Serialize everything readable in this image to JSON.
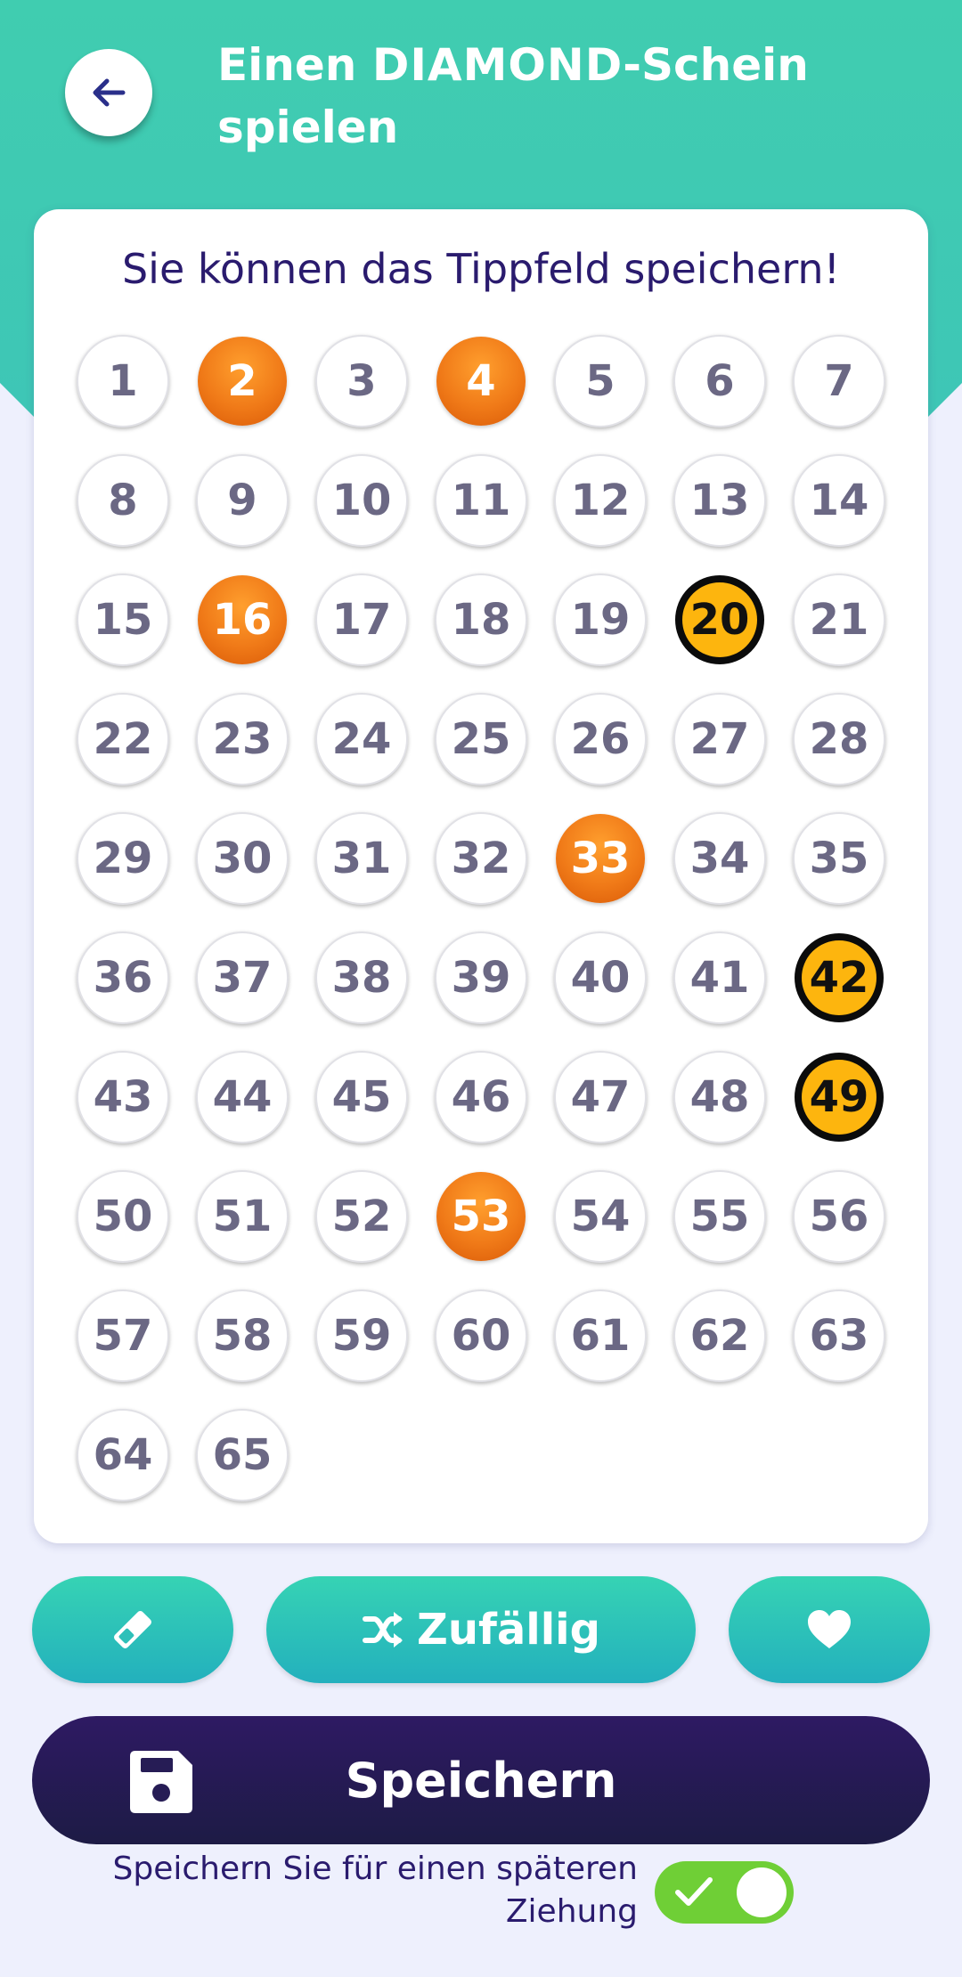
{
  "header": {
    "title_prefix": "Einen ",
    "title_brand": "DIAMOND",
    "title_suffix": "-Schein",
    "title_line2": "spielen"
  },
  "card": {
    "info": "Sie können das Tippfeld speichern!"
  },
  "numbers": {
    "max": 65,
    "columns": 7,
    "selected": [
      2,
      4,
      16,
      33,
      53
    ],
    "bonus": [
      20,
      42,
      49
    ]
  },
  "actions": {
    "random_label": "Zufällig",
    "save_label": "Speichern"
  },
  "later_draw": {
    "line1": "Speichern Sie für einen späteren",
    "line2": "Ziehung",
    "enabled": true
  },
  "colors": {
    "header": "#40cdb0",
    "selected": "#f07a18",
    "bonus": "#fdb50e",
    "save_button": "#2e1a63",
    "toggle_on": "#6fcf36"
  },
  "icons": [
    "arrow-left-icon",
    "eraser-icon",
    "shuffle-icon",
    "heart-icon",
    "floppy-disk-icon",
    "checkmark-icon"
  ]
}
